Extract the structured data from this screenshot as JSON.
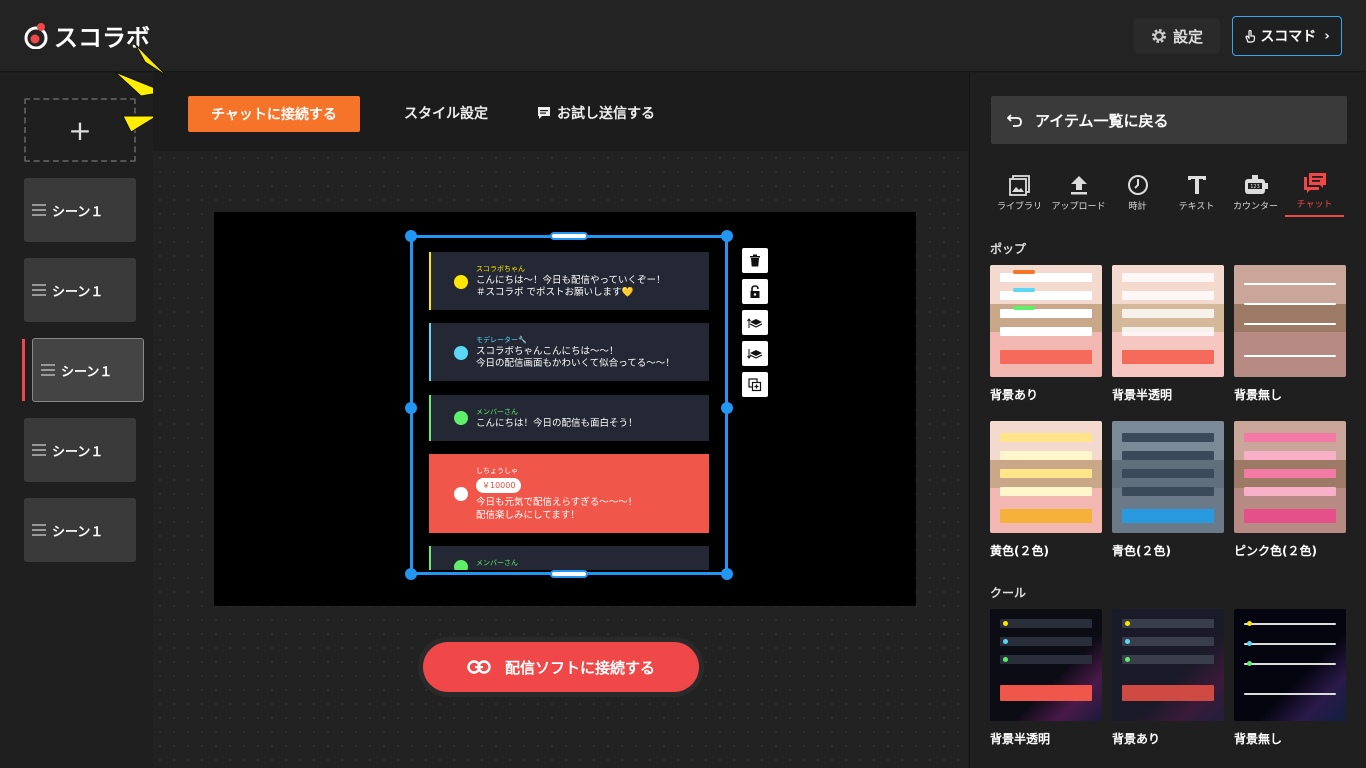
{
  "header": {
    "logo_text": "スコラボ",
    "settings_label": "設定",
    "scomado_label": "スコマド"
  },
  "sidebar": {
    "add_label": "+",
    "scenes": [
      {
        "label": "シーン１"
      },
      {
        "label": "シーン１"
      },
      {
        "label": "シーン１"
      },
      {
        "label": "シーン１"
      },
      {
        "label": "シーン１"
      }
    ]
  },
  "toolbar": {
    "connect_chat_label": "チャットに接続する",
    "style_tab_label": "スタイル設定",
    "test_send_label": "お試し送信する"
  },
  "preview": {
    "messages": [
      {
        "name": "スコラボちゃん",
        "lines": [
          "こんにちは～！今日も配信やっていくぞー！",
          "＃スコラボ でポストお願いします💛"
        ],
        "color": "#ffe600"
      },
      {
        "name": "モデレーター🔧",
        "lines": [
          "スコラボちゃんこんにちは～～！",
          "今日の配信画面もかわいくて似合ってる～～！"
        ],
        "color": "#5ad8f5"
      },
      {
        "name": "メンバーさん",
        "lines": [
          "こんにちは！今日の配信も面白そう！"
        ],
        "color": "#5ef06a"
      },
      {
        "name": "しちょうしゃ",
        "amount": "￥10000",
        "lines": [
          "今日も元気で配信えらすぎる～～～！",
          "配信楽しみにしてます！"
        ],
        "color": "#ffffff"
      },
      {
        "name": "メンバーさん",
        "lines": [
          ""
        ],
        "color": "#5ef06a"
      }
    ],
    "stream_button_label": "配信ソフトに接続する"
  },
  "right_panel": {
    "back_label": "アイテム一覧に戻る",
    "tabs": [
      {
        "label": "ライブラリ",
        "icon": "image-icon"
      },
      {
        "label": "アップロード",
        "icon": "upload-icon"
      },
      {
        "label": "時計",
        "icon": "clock-icon"
      },
      {
        "label": "テキスト",
        "icon": "text-icon"
      },
      {
        "label": "カウンター",
        "icon": "counter-icon"
      },
      {
        "label": "チャット",
        "icon": "chat-icon",
        "active": true
      }
    ],
    "sections": [
      {
        "title": "ポップ",
        "items": [
          {
            "label": "背景あり"
          },
          {
            "label": "背景半透明"
          },
          {
            "label": "背景無し"
          },
          {
            "label": "黄色(２色)"
          },
          {
            "label": "青色(２色)"
          },
          {
            "label": "ピンク色(２色)"
          }
        ]
      },
      {
        "title": "クール",
        "items": [
          {
            "label": "背景半透明"
          },
          {
            "label": "背景あり"
          },
          {
            "label": "背景無し"
          }
        ]
      }
    ]
  },
  "colors": {
    "accent_red": "#f04848",
    "accent_orange": "#f5742a",
    "selection_blue": "#2196f3"
  }
}
